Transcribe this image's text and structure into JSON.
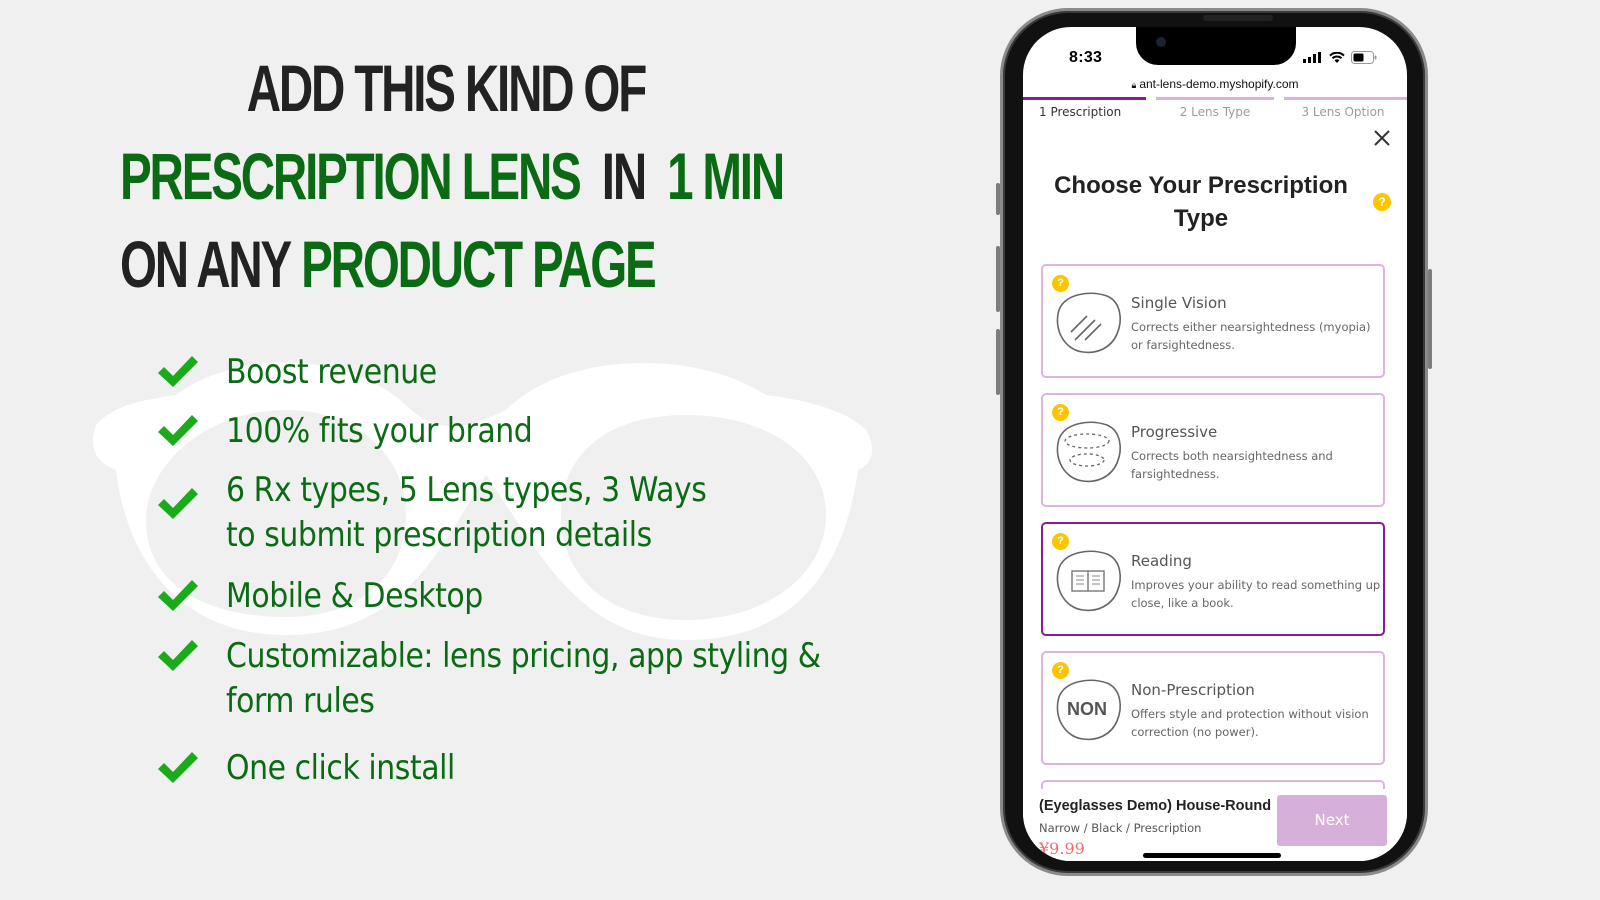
{
  "headline": {
    "line1": [
      {
        "text": "ADD THIS KIND OF",
        "tone": "dark"
      }
    ],
    "line2": [
      {
        "text": "PRESCRIPTION LENS",
        "tone": "green"
      },
      {
        "text": "IN",
        "tone": "dark"
      },
      {
        "text": "1 MIN",
        "tone": "green"
      }
    ],
    "line3": [
      {
        "text": "ON ANY",
        "tone": "dark"
      },
      {
        "text": "PRODUCT PAGE",
        "tone": "green"
      }
    ]
  },
  "features": [
    {
      "text": "Boost revenue"
    },
    {
      "text": "100% fits your brand"
    },
    {
      "text": "6 Rx types, 5 Lens types, 3 Ways\nto submit prescription details"
    },
    {
      "text": "Mobile & Desktop"
    },
    {
      "text": "Customizable: lens pricing, app styling &\nform rules"
    },
    {
      "text": "One click install"
    }
  ],
  "colors": {
    "headline_dark": "#222222",
    "headline_green": "#0b6b14",
    "check_green": "#1aaa1a",
    "accent_purple": "#8b1a94",
    "accent_light_purple": "#dfb3e0",
    "help_yellow": "#fdc500",
    "price_red": "#f06a6a"
  },
  "phone": {
    "status": {
      "time": "8:33",
      "icons": [
        "signal-icon",
        "wifi-icon",
        "battery-icon"
      ]
    },
    "url": "ant-lens-demo.myshopify.com",
    "steps": [
      {
        "label": "1 Prescription",
        "active": true
      },
      {
        "label": "2 Lens Type",
        "active": false
      },
      {
        "label": "3 Lens Option",
        "active": false
      }
    ],
    "title": "Choose Your Prescription Type",
    "options": [
      {
        "icon": "single-vision-icon",
        "title": "Single Vision",
        "desc": "Corrects either nearsightedness (myopia) or farsightedness.",
        "selected": false
      },
      {
        "icon": "progressive-icon",
        "title": "Progressive",
        "desc": "Corrects both nearsightedness and farsightedness.",
        "selected": false
      },
      {
        "icon": "reading-book-icon",
        "title": "Reading",
        "desc": "Improves your ability to read something up close, like a book.",
        "selected": true
      },
      {
        "icon": "non-prescription-icon",
        "icon_text": "NON",
        "title": "Non-Prescription",
        "desc": "Offers style and protection without vision correction (no power).",
        "selected": false
      }
    ],
    "footer": {
      "product_name": "(Eyeglasses Demo) House-Round",
      "variant": "Narrow / Black / Prescription",
      "price": "¥9.99",
      "next_label": "Next"
    }
  }
}
